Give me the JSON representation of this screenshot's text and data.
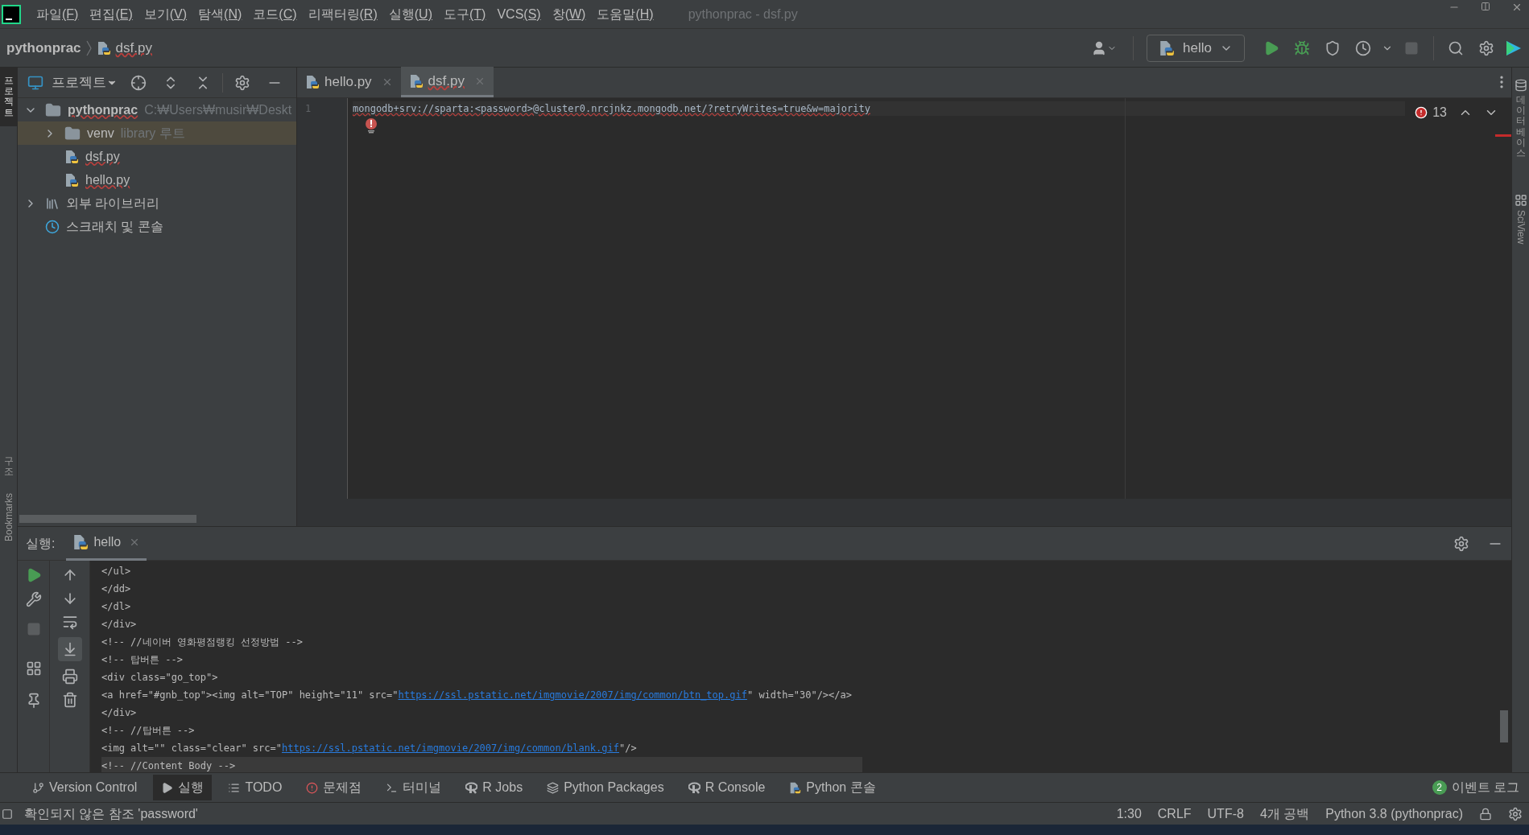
{
  "window": {
    "title": "pythonprac - dsf.py"
  },
  "menu": [
    {
      "label": "파일",
      "mnemonic": "(F)"
    },
    {
      "label": "편집",
      "mnemonic": "(E)"
    },
    {
      "label": "보기",
      "mnemonic": "(V)"
    },
    {
      "label": "탐색",
      "mnemonic": "(N)"
    },
    {
      "label": "코드",
      "mnemonic": "(C)"
    },
    {
      "label": "리팩터링",
      "mnemonic": "(R)"
    },
    {
      "label": "실행",
      "mnemonic": "(U)"
    },
    {
      "label": "도구",
      "mnemonic": "(T)"
    },
    {
      "label": "VCS",
      "mnemonic": "(S)"
    },
    {
      "label": "창",
      "mnemonic": "(W)"
    },
    {
      "label": "도움말",
      "mnemonic": "(H)"
    }
  ],
  "breadcrumb": [
    "pythonprac",
    "dsf.py"
  ],
  "run_config": {
    "label": "hello"
  },
  "left_stripe": [
    {
      "label": "프로젝트",
      "selected": true
    },
    {
      "label": "구조",
      "selected": false
    },
    {
      "label": "Bookmarks",
      "selected": false
    }
  ],
  "right_stripe": [
    {
      "label": "데이터베이스",
      "kind": "database"
    },
    {
      "label": "SciView",
      "kind": "grid"
    }
  ],
  "project_panel": {
    "title": "프로젝트",
    "tree": [
      {
        "label": "pythonprac",
        "kind": "project",
        "note": "C:₩Users₩musir₩Deskt",
        "expanded": true,
        "selected": false,
        "children": [
          {
            "label": "venv",
            "kind": "folder",
            "note": "library 루트",
            "expanded": false,
            "selected": true
          },
          {
            "label": "dsf.py",
            "kind": "python",
            "selected": false
          },
          {
            "label": "hello.py",
            "kind": "python",
            "selected": false
          }
        ]
      },
      {
        "label": "외부 라이브러리",
        "kind": "libraries",
        "expanded": false,
        "selected": false
      },
      {
        "label": "스크래치 및 콘솔",
        "kind": "scratches",
        "selected": false
      }
    ]
  },
  "editor": {
    "tabs": [
      {
        "label": "hello.py",
        "selected": false
      },
      {
        "label": "dsf.py",
        "selected": true
      }
    ],
    "lines": [
      {
        "number": "1",
        "code": "mongodb+srv://sparta:<password>@cluster0.nrcjnkz.mongodb.net/?retryWrites=true&w=majority"
      }
    ],
    "error_count": "13"
  },
  "run_panel": {
    "label": "실행:",
    "tab": "hello",
    "lines": [
      {
        "parts": [
          {
            "kind": "text",
            "text": "</ul>"
          }
        ],
        "highlighted": false
      },
      {
        "parts": [
          {
            "kind": "text",
            "text": "</dd>"
          }
        ],
        "highlighted": false
      },
      {
        "parts": [
          {
            "kind": "text",
            "text": "</dl>"
          }
        ],
        "highlighted": false
      },
      {
        "parts": [
          {
            "kind": "text",
            "text": "</div>"
          }
        ],
        "highlighted": false
      },
      {
        "parts": [
          {
            "kind": "text",
            "text": "<!-- //네이버 영화평점랭킹 선정방법 -->"
          }
        ],
        "highlighted": false
      },
      {
        "parts": [
          {
            "kind": "text",
            "text": "<!-- 탑버튼 -->"
          }
        ],
        "highlighted": false
      },
      {
        "parts": [
          {
            "kind": "text",
            "text": "<div class=\"go_top\">"
          }
        ],
        "highlighted": false
      },
      {
        "parts": [
          {
            "kind": "text",
            "text": "<a href=\"#gnb_top\"><img alt=\"TOP\" height=\"11\" src=\""
          },
          {
            "kind": "link",
            "text": "https://ssl.pstatic.net/imgmovie/2007/img/common/btn_top.gif"
          },
          {
            "kind": "text",
            "text": "\" width=\"30\"/></a>"
          }
        ],
        "highlighted": false
      },
      {
        "parts": [
          {
            "kind": "text",
            "text": "</div>"
          }
        ],
        "highlighted": false
      },
      {
        "parts": [
          {
            "kind": "text",
            "text": "<!-- //탑버튼 -->"
          }
        ],
        "highlighted": false
      },
      {
        "parts": [
          {
            "kind": "text",
            "text": "<img alt=\"\" class=\"clear\" src=\""
          },
          {
            "kind": "link",
            "text": "https://ssl.pstatic.net/imgmovie/2007/img/common/blank.gif"
          },
          {
            "kind": "text",
            "text": "\"/>"
          }
        ],
        "highlighted": false
      },
      {
        "parts": [
          {
            "kind": "text",
            "text": "<!-- //Content Body -->"
          }
        ],
        "highlighted": true
      }
    ]
  },
  "tool_tabs": [
    {
      "label": "Version Control",
      "kind": "vcs",
      "selected": false
    },
    {
      "label": "실행",
      "kind": "run",
      "selected": true
    },
    {
      "label": "TODO",
      "kind": "todo",
      "selected": false
    },
    {
      "label": "문제점",
      "kind": "problems",
      "selected": false
    },
    {
      "label": "터미널",
      "kind": "terminal",
      "selected": false
    },
    {
      "label": "R Jobs",
      "kind": "r",
      "selected": false
    },
    {
      "label": "Python Packages",
      "kind": "packages",
      "selected": false
    },
    {
      "label": "R Console",
      "kind": "r",
      "selected": false
    },
    {
      "label": "Python 콘솔",
      "kind": "python",
      "selected": false
    }
  ],
  "event_log": {
    "count": "2",
    "label": "이벤트 로그"
  },
  "status_bar": {
    "message": "확인되지 않은 참조 'password'",
    "items": [
      "1:30",
      "CRLF",
      "UTF-8",
      "4개 공백",
      "Python 3.8 (pythonprac)"
    ]
  }
}
